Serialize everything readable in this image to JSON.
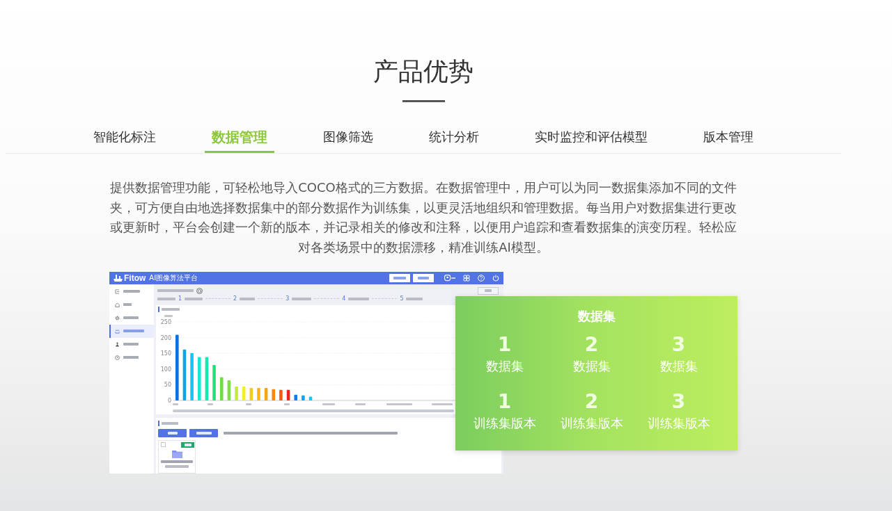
{
  "section": {
    "title": "产品优势"
  },
  "tabs": [
    {
      "label": "智能化标注",
      "selected": false
    },
    {
      "label": "数据管理",
      "selected": true
    },
    {
      "label": "图像筛选",
      "selected": false
    },
    {
      "label": "统计分析",
      "selected": false
    },
    {
      "label": "实时监控和评估模型",
      "selected": false
    },
    {
      "label": "版本管理",
      "selected": false
    }
  ],
  "description": "提供数据管理功能，可轻松地导入COCO格式的三方数据。在数据管理中，用户可以为同一数据集添加不同的文件夹，可方便自由地选择数据集中的部分数据作为训练集，以更灵活地组织和管理数据。每当用户对数据集进行更改或更新时，平台会创建一个新的版本，并记录相关的修改和注释，以便用户追踪和查看数据集的演变历程。轻松应对各类场景中的数据漂移，精准训练AI模型。",
  "screenshot": {
    "logo": "Fitow",
    "app_title": "AI图像算法平台",
    "sidebar_items": [
      {
        "selected": false
      },
      {
        "selected": false
      },
      {
        "selected": false
      },
      {
        "selected": true
      },
      {
        "selected": false
      },
      {
        "selected": false
      }
    ],
    "step_numbers": [
      "1",
      "2",
      "3",
      "4",
      "5"
    ],
    "chart_data": {
      "type": "bar",
      "ylim": [
        0,
        250
      ],
      "yticks": [
        0,
        50,
        100,
        150,
        200,
        250
      ],
      "grid": true,
      "values": [
        209,
        162,
        151,
        138,
        138,
        113,
        74,
        64,
        44,
        44,
        40,
        40,
        40,
        36,
        34,
        34,
        18,
        16,
        12,
        0,
        0,
        0,
        0,
        0,
        0,
        0,
        0,
        0,
        0,
        0,
        0,
        0,
        0,
        0,
        0,
        0,
        0,
        0
      ]
    },
    "files": [
      {
        "checked": false
      }
    ]
  },
  "stats_card": {
    "title": "数据集",
    "rows": [
      {
        "items": [
          {
            "value": "1",
            "label": "数据集"
          },
          {
            "value": "2",
            "label": "数据集"
          },
          {
            "value": "3",
            "label": "数据集"
          }
        ]
      },
      {
        "items": [
          {
            "value": "1",
            "label": "训练集版本"
          },
          {
            "value": "2",
            "label": "训练集版本"
          },
          {
            "value": "3",
            "label": "训练集版本"
          }
        ]
      }
    ]
  }
}
